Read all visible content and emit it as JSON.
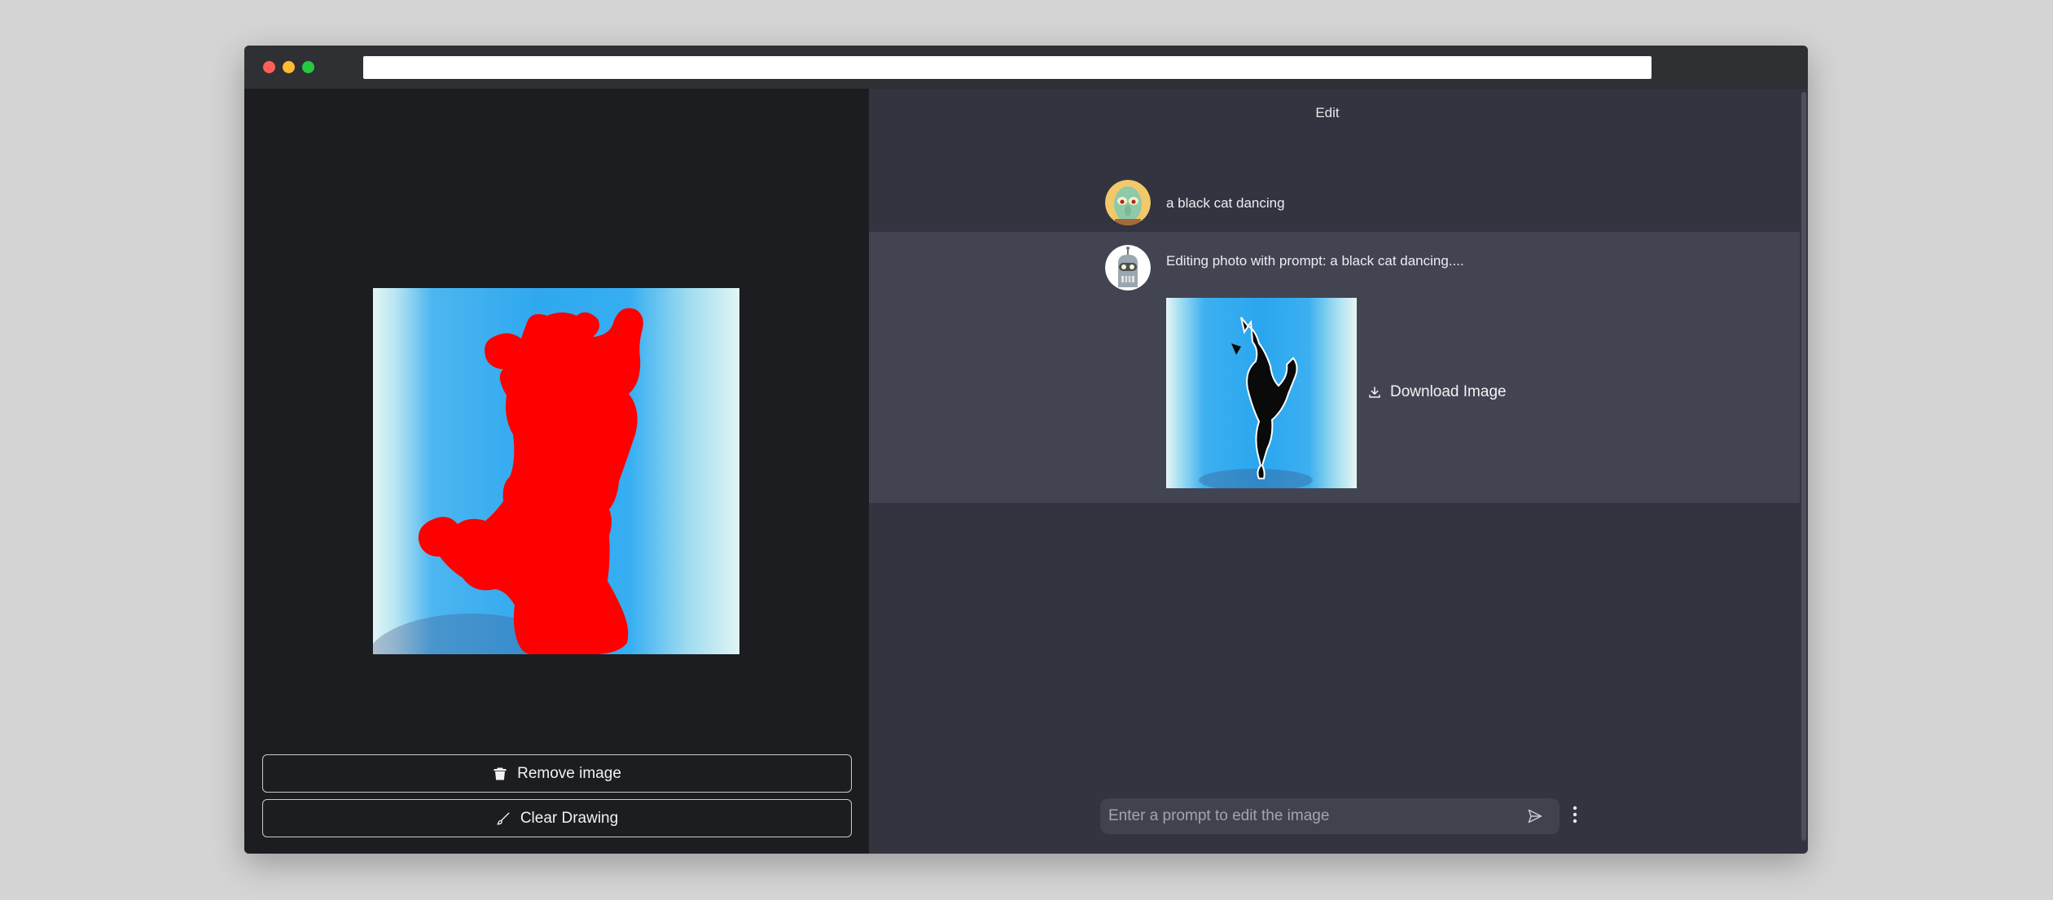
{
  "window": {
    "url": ""
  },
  "canvas_panel": {
    "remove_label": "Remove image",
    "clear_label": "Clear Drawing"
  },
  "chat": {
    "title": "Edit",
    "messages": [
      {
        "role": "user",
        "text": "a black cat dancing",
        "avatar": "squidward-avatar"
      },
      {
        "role": "assistant",
        "text": "Editing photo with prompt: a black cat dancing....",
        "avatar": "robot-avatar"
      }
    ],
    "download_label": "Download Image",
    "prompt_placeholder": "Enter a prompt to edit the image",
    "prompt_value": ""
  },
  "colors": {
    "mask": "#ff0000",
    "left_bg": "#1c1d20",
    "chat_bg": "#33343f",
    "bot_row_bg": "#434452"
  }
}
